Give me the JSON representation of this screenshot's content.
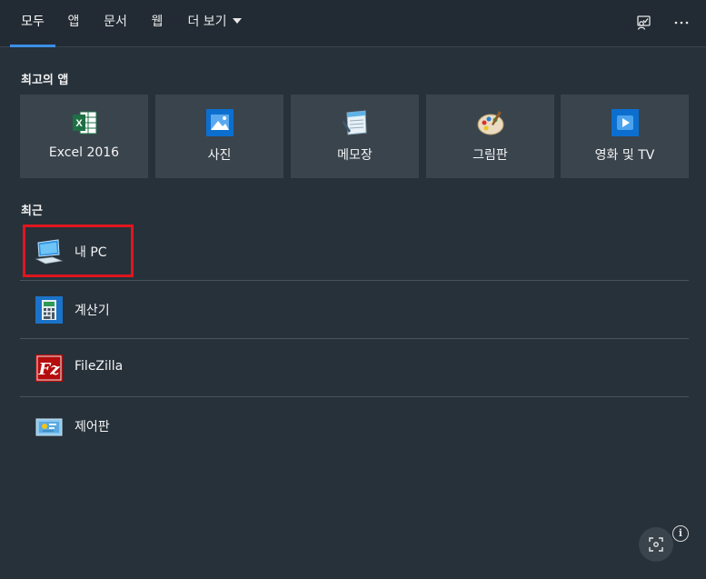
{
  "tabs": [
    {
      "label": "모두",
      "active": true
    },
    {
      "label": "앱"
    },
    {
      "label": "문서"
    },
    {
      "label": "웹"
    },
    {
      "label": "더 보기"
    }
  ],
  "top_icons": [
    "feedback-icon",
    "more-icon"
  ],
  "top_apps": {
    "title": "최고의 앱",
    "items": [
      {
        "label": "Excel 2016",
        "icon": "excel-icon"
      },
      {
        "label": "사진",
        "icon": "photos-icon"
      },
      {
        "label": "메모장",
        "icon": "notepad-icon"
      },
      {
        "label": "그림판",
        "icon": "paint-icon"
      },
      {
        "label": "영화 및 TV",
        "icon": "movies-tv-icon"
      }
    ]
  },
  "recent": {
    "title": "최근",
    "items": [
      {
        "label": "내 PC",
        "icon": "this-pc-icon",
        "highlighted": true
      },
      {
        "label": "계산기",
        "icon": "calculator-icon"
      },
      {
        "label": "FileZilla",
        "icon": "filezilla-icon"
      },
      {
        "label": "제어판",
        "icon": "control-panel-icon"
      }
    ]
  },
  "info_glyph": "i",
  "colors": {
    "accent": "#3b8ee8",
    "highlight": "#e0161e",
    "background": "#27313a",
    "tile": "#3a444d"
  }
}
